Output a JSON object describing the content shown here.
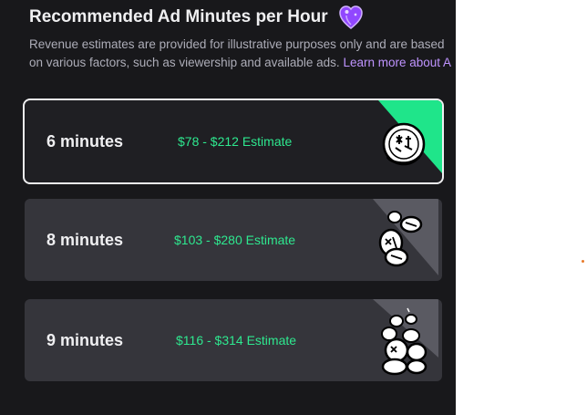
{
  "header": {
    "title": "Recommended Ad Minutes per Hour",
    "icon": "purple-heart-icon"
  },
  "description": {
    "line1": "Revenue estimates are provided for illustrative purposes only and are based",
    "line2_prefix": "on various factors, such as viewership and available ads. ",
    "link_label": "Learn more about A"
  },
  "options": [
    {
      "minutes": "6 minutes",
      "estimate": "$78 - $212 Estimate",
      "selected": true,
      "icon": "single-coin-icon"
    },
    {
      "minutes": "8 minutes",
      "estimate": "$103 - $280 Estimate",
      "selected": false,
      "icon": "coin-stack-icon"
    },
    {
      "minutes": "9 minutes",
      "estimate": "$116 - $314 Estimate",
      "selected": false,
      "icon": "coin-pile-icon"
    }
  ],
  "colors": {
    "panel_bg": "#18181b",
    "card_bg": "#35353b",
    "selected_card_bg": "#1f1f23",
    "estimate_green": "#2ee88f",
    "link_purple": "#bf94ff",
    "accent_purple": "#9147ff"
  }
}
